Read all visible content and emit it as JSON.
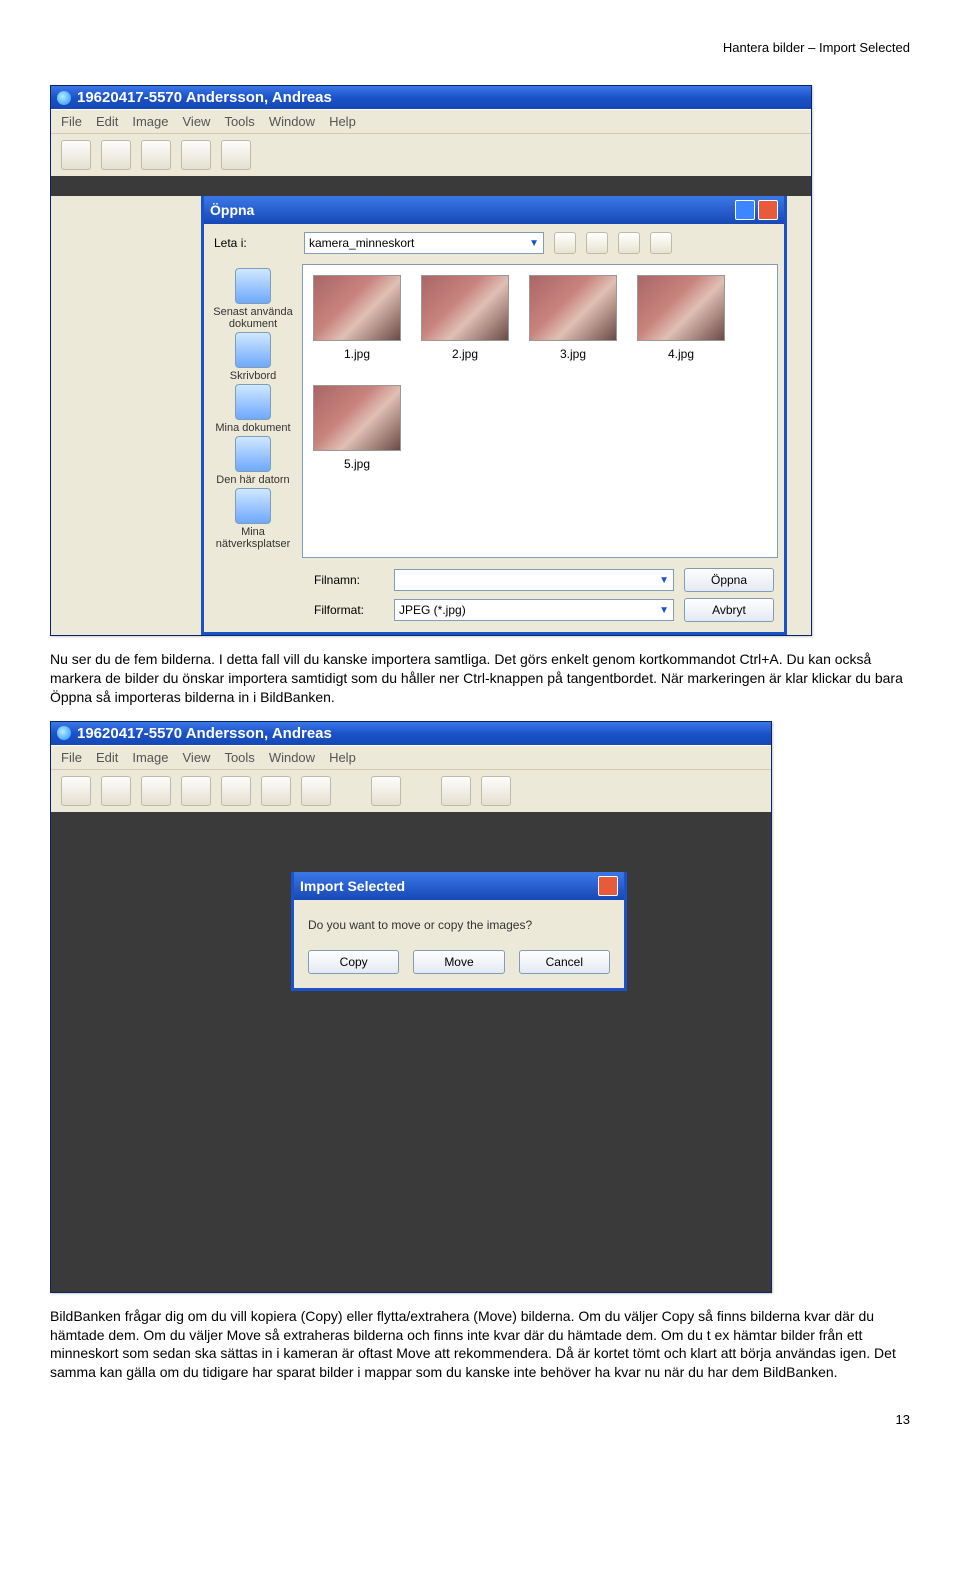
{
  "header": "Hantera bilder – Import Selected",
  "page_number": "13",
  "app_window": {
    "title": "19620417-5570 Andersson, Andreas",
    "menu": [
      "File",
      "Edit",
      "Image",
      "View",
      "Tools",
      "Window",
      "Help"
    ]
  },
  "open_dialog": {
    "title": "Öppna",
    "look_in_label": "Leta i:",
    "look_in_value": "kamera_minneskort",
    "places": [
      {
        "label": "Senast använda dokument"
      },
      {
        "label": "Skrivbord"
      },
      {
        "label": "Mina dokument"
      },
      {
        "label": "Den här datorn"
      },
      {
        "label": "Mina nätverksplatser"
      }
    ],
    "files": [
      {
        "name": "1.jpg"
      },
      {
        "name": "2.jpg"
      },
      {
        "name": "3.jpg"
      },
      {
        "name": "4.jpg"
      },
      {
        "name": "5.jpg"
      }
    ],
    "filename_label": "Filnamn:",
    "filename_value": "",
    "filetype_label": "Filformat:",
    "filetype_value": "JPEG (*.jpg)",
    "open_btn": "Öppna",
    "cancel_btn": "Avbryt"
  },
  "import_dialog": {
    "title": "Import Selected",
    "question": "Do you want to move or copy the images?",
    "copy": "Copy",
    "move": "Move",
    "cancel": "Cancel"
  },
  "para1": "Nu ser du de fem bilderna. I detta fall vill du kanske importera samtliga. Det görs enkelt genom kortkommandot Ctrl+A. Du kan också markera de bilder du önskar importera samtidigt som du håller ner Ctrl-knappen på tangentbordet. När markeringen är klar klickar du bara Öppna så importeras bilderna in i BildBanken.",
  "para2": "BildBanken frågar dig om du vill kopiera (Copy) eller flytta/extrahera (Move) bilderna. Om du väljer Copy så finns bilderna kvar där du hämtade dem. Om du väljer Move så extraheras bilderna och finns inte kvar där du hämtade dem. Om du t ex hämtar bilder från ett minneskort som sedan ska sättas in i kameran är oftast Move att rekommendera. Då är kortet tömt och klart att börja användas igen. Det samma kan gälla om du tidigare har sparat bilder i mappar som du kanske inte behöver ha kvar nu när du har dem BildBanken."
}
